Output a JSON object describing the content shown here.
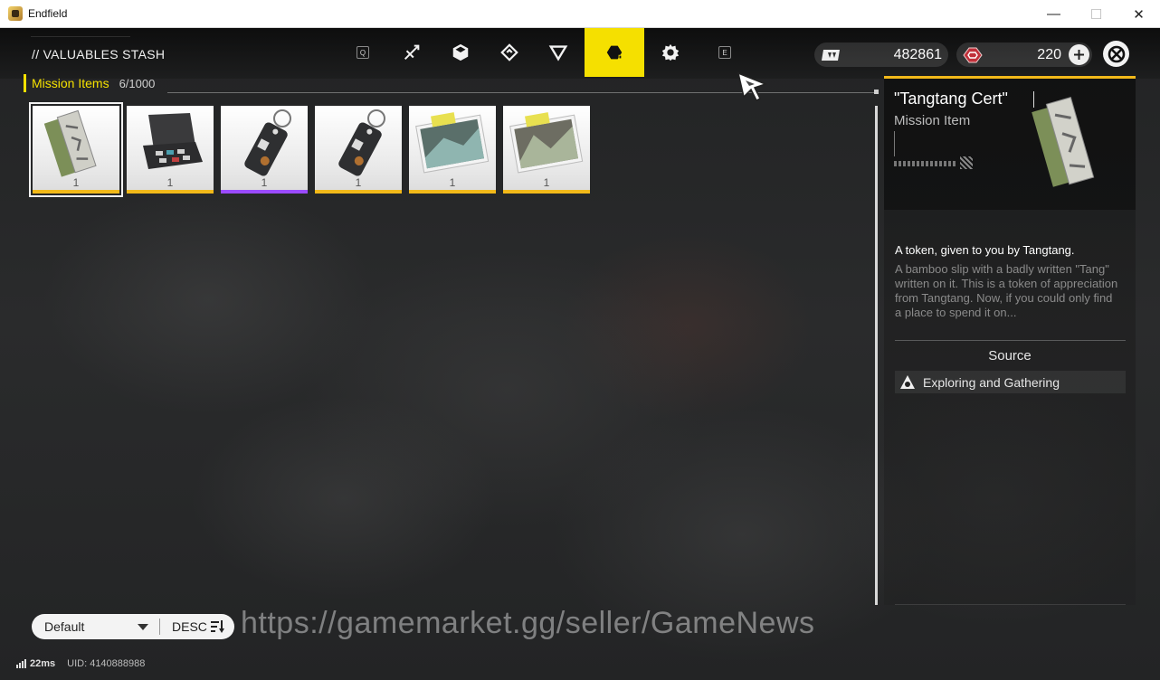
{
  "window": {
    "title": "Endfield",
    "minimize": "—",
    "maximize": "☐",
    "close": "✕"
  },
  "header": {
    "title": "// VALUABLES STASH"
  },
  "tabs": {
    "prev_key": "Q",
    "next_key": "E",
    "items": [
      {
        "icon": "weapon-icon"
      },
      {
        "icon": "cube-icon"
      },
      {
        "icon": "diamond-arrow-icon"
      },
      {
        "icon": "triangle-icon"
      },
      {
        "icon": "mission-item-icon",
        "active": true
      },
      {
        "icon": "gear-icon"
      }
    ]
  },
  "currencies": [
    {
      "icon": "credit-icon",
      "value": "482861"
    },
    {
      "icon": "origeometry-icon",
      "value": "220"
    }
  ],
  "category": {
    "label": "Mission Items",
    "count": "6/1000"
  },
  "items": [
    {
      "name": "tangtang-cert",
      "qty": "1",
      "rarity": "gold",
      "selected": true
    },
    {
      "name": "toolbox",
      "qty": "1",
      "rarity": "gold"
    },
    {
      "name": "keychain-tag",
      "qty": "1",
      "rarity": "purple"
    },
    {
      "name": "keychain-tag-2",
      "qty": "1",
      "rarity": "gold"
    },
    {
      "name": "photo-1",
      "qty": "1",
      "rarity": "gold"
    },
    {
      "name": "photo-2",
      "qty": "1",
      "rarity": "gold"
    }
  ],
  "detail": {
    "name": "\"Tangtang Cert\"",
    "type": "Mission Item",
    "desc_title": "A token, given to you by Tangtang.",
    "desc_body": "A bamboo slip with a badly written \"Tang\" written on it. This is a token of appreciation from Tangtang. Now, if you could only find a place to spend it on...",
    "source_heading": "Source",
    "source_label": "Exploring and Gathering"
  },
  "sort": {
    "mode": "Default",
    "order": "DESC"
  },
  "watermark": "https://gamemarket.gg/seller/GameNews",
  "footer": {
    "ping": "22ms",
    "uid": "UID: 4140888988"
  },
  "colors": {
    "accent": "#f5e000",
    "rarity_gold": "#f2b91a",
    "rarity_purple": "#9b4bff"
  }
}
